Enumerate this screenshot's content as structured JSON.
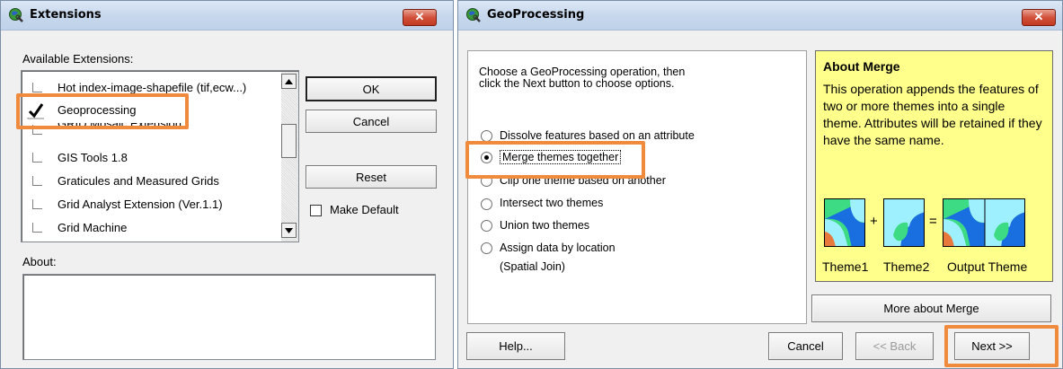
{
  "extensions_window": {
    "title": "Extensions",
    "close_label": "✕",
    "available_label": "Available Extensions:",
    "items": [
      {
        "label": "Hot index-image-shapefile (tif,ecw...)",
        "checked": false
      },
      {
        "label": "Geoprocessing",
        "checked": true
      },
      {
        "label": "GRID Mosaic Extension",
        "checked": false
      },
      {
        "label": "GIS Tools 1.8",
        "checked": false
      },
      {
        "label": "Graticules and Measured Grids",
        "checked": false
      },
      {
        "label": "Grid Analyst Extension (Ver.1.1)",
        "checked": false
      },
      {
        "label": "Grid Machine",
        "checked": false
      }
    ],
    "ok_label": "OK",
    "cancel_label": "Cancel",
    "reset_label": "Reset",
    "make_default_label": "Make Default",
    "about_label": "About:"
  },
  "geo_window": {
    "title": "GeoProcessing",
    "close_label": "✕",
    "instructions": "Choose a GeoProcessing operation, then click the Next button to choose options.",
    "options": [
      {
        "label": "Dissolve features based on an attribute",
        "selected": false
      },
      {
        "label": "Merge themes together",
        "selected": true
      },
      {
        "label": "Clip one theme based on another",
        "selected": false
      },
      {
        "label": "Intersect two themes",
        "selected": false
      },
      {
        "label": "Union two themes",
        "selected": false
      },
      {
        "label": "Assign data by location",
        "sub": "(Spatial Join)",
        "selected": false
      }
    ],
    "about": {
      "title": "About Merge",
      "text": "This operation appends the features of two or more themes into a single theme.  Attributes will be retained if they have the same name.",
      "plus": "+",
      "equals": "=",
      "captions": [
        "Theme1",
        "Theme2",
        "Output Theme"
      ]
    },
    "more_about_label": "More about Merge",
    "help_label": "Help...",
    "cancel_label": "Cancel",
    "back_label": "<< Back",
    "next_label": "Next >>"
  },
  "colors": {
    "highlight": "#f08a3c",
    "about_bg": "#ffff8c",
    "map_green": "#3ddc84",
    "map_cyan": "#9ff0ff",
    "map_blue": "#1a6fe0",
    "map_orange": "#e8783c"
  }
}
